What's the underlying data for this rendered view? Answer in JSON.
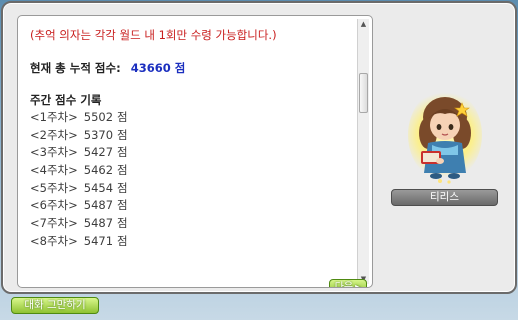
{
  "dialog": {
    "notice": "(추억 의자는 각각 월드 내 1회만 수령 가능합니다.)",
    "total_label": "현재 총 누적 점수:",
    "total_value": "43660 점",
    "weekly_title": "주간 점수 기록",
    "weekly_records": [
      {
        "week": "<1주차>",
        "score": "5502",
        "unit": "점"
      },
      {
        "week": "<2주차>",
        "score": "5370",
        "unit": "점"
      },
      {
        "week": "<3주차>",
        "score": "5427",
        "unit": "점"
      },
      {
        "week": "<4주차>",
        "score": "5462",
        "unit": "점"
      },
      {
        "week": "<5주차>",
        "score": "5454",
        "unit": "점"
      },
      {
        "week": "<6주차>",
        "score": "5487",
        "unit": "점"
      },
      {
        "week": "<7주차>",
        "score": "5487",
        "unit": "점"
      },
      {
        "week": "<8주차>",
        "score": "5471",
        "unit": "점"
      }
    ],
    "next_label": "다음"
  },
  "npc": {
    "name": "티리스"
  },
  "footer": {
    "end_chat_label": "대화 그만하기"
  },
  "colors": {
    "notice": "#c81d1d",
    "total_value": "#1b2fbf",
    "button_green": "#8ac02f"
  }
}
